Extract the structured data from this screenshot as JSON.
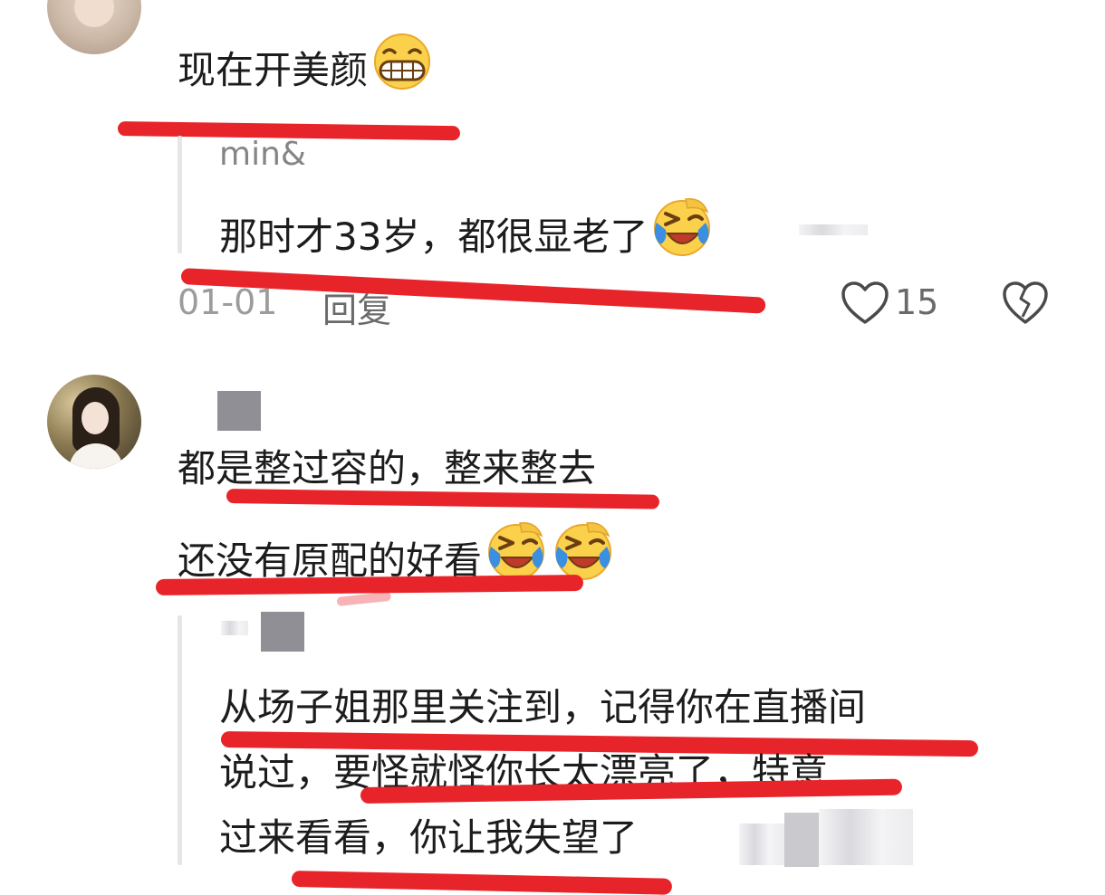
{
  "comments": [
    {
      "text_parts": [
        "现在开美颜"
      ],
      "emoji": "grinning-face-emoji",
      "reply": {
        "username": "min&",
        "text": "那时才33岁，都很显老了",
        "emoji": "loudly-laughing-emoji",
        "date": "01-01",
        "reply_label": "回复",
        "like_count": "15"
      }
    },
    {
      "line1": "都是整过容的，整来整去",
      "line2": "还没有原配的好看",
      "emoji": "loudly-laughing-emoji",
      "reply": {
        "line1": "从场子姐那里关注到，记得你在直播间",
        "line2": "说过，要怪就怪你长太漂亮了，特意",
        "line3": "过来看看，你让我失望了"
      }
    }
  ],
  "colors": {
    "annotation_red": "#e8242b",
    "text_primary": "#1c1c1c",
    "text_meta": "#9c9c9c"
  }
}
